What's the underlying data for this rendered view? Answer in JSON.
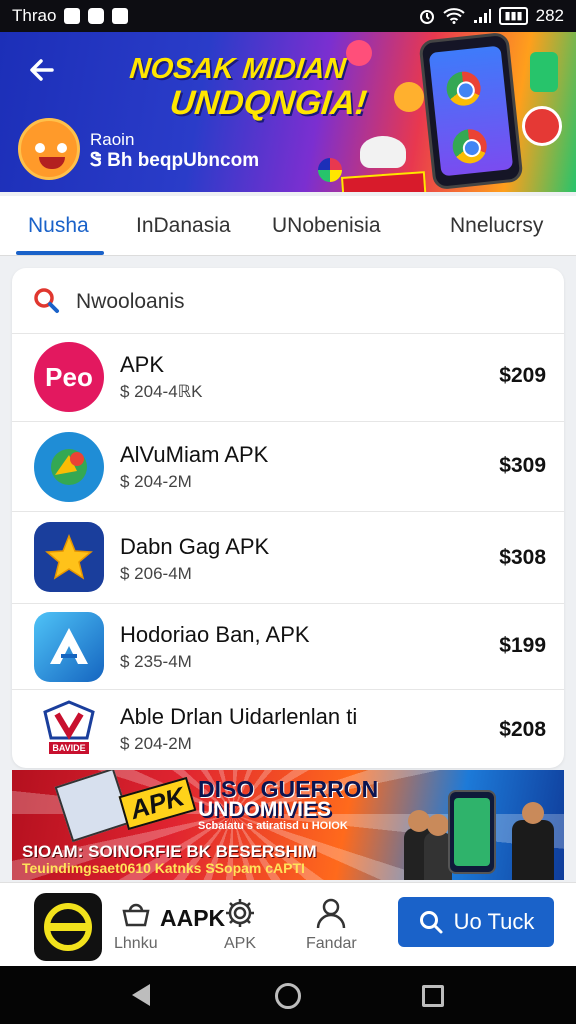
{
  "status_bar": {
    "carrier": "Thrao",
    "time": "282"
  },
  "hero": {
    "title_line1": "NOSAK MIDIAN",
    "title_line2": "UNDQNGIA!",
    "subtitle1": "Raoin",
    "subtitle2": "Ꮥ Bh beqpUbncom"
  },
  "tabs": [
    {
      "label": "Nusha",
      "active": true
    },
    {
      "label": "InDanasia",
      "active": false
    },
    {
      "label": "UNobenisia",
      "active": false
    },
    {
      "label": "Nnelucrsy",
      "active": false
    }
  ],
  "list": {
    "title": "Nwooloanis",
    "apps": [
      {
        "icon_text": "Peo",
        "name": "APK",
        "meta": "$ 204-4ℝK",
        "price": "$209",
        "icon": "peo-icon",
        "color": "#e3185f"
      },
      {
        "icon_text": "",
        "name": "AlVuMiam APK",
        "meta": "$ 204-2M",
        "price": "$309",
        "icon": "map-pin-icon",
        "color": "#1f8dd6"
      },
      {
        "icon_text": "",
        "name": "Dabn Gag APK",
        "meta": "$ 206-4M",
        "price": "$308",
        "icon": "star-icon",
        "color": "#1a3e9c"
      },
      {
        "icon_text": "",
        "name": "Hodoriao Ban, APK",
        "meta": "$ 235-4M",
        "price": "$199",
        "icon": "a-logo-icon",
        "color": "#2196f3"
      },
      {
        "icon_text": "BAVIDE",
        "name": "Able Drlan Uidarlenlan ti",
        "meta": "$ 204-2M",
        "price": "$208",
        "icon": "shield-logo-icon",
        "color": "#c8102e"
      }
    ]
  },
  "promo": {
    "badge": "APK",
    "line1": "DISO GUERRON",
    "line2": "UNDOMIVIES",
    "line3": "Scbaiatu s atiratisd u HOIOK",
    "line4": "SIOAM: SOINORFIE BK BESERSHIM",
    "line5": "Teuindimgsaet0610 Katnks SSopam cAPTI"
  },
  "bottom_nav": {
    "aapk_label": "AAPK",
    "items": [
      {
        "label": "Lhnku",
        "icon": "basket-icon"
      },
      {
        "label": "APK",
        "icon": "gear-icon"
      },
      {
        "label": "Fandar",
        "icon": "person-icon"
      }
    ],
    "cta_label": "Uo Tuck"
  },
  "colors": {
    "accent": "#1a62c9",
    "hero_title": "#ffe600",
    "promo_red": "#e02430"
  }
}
